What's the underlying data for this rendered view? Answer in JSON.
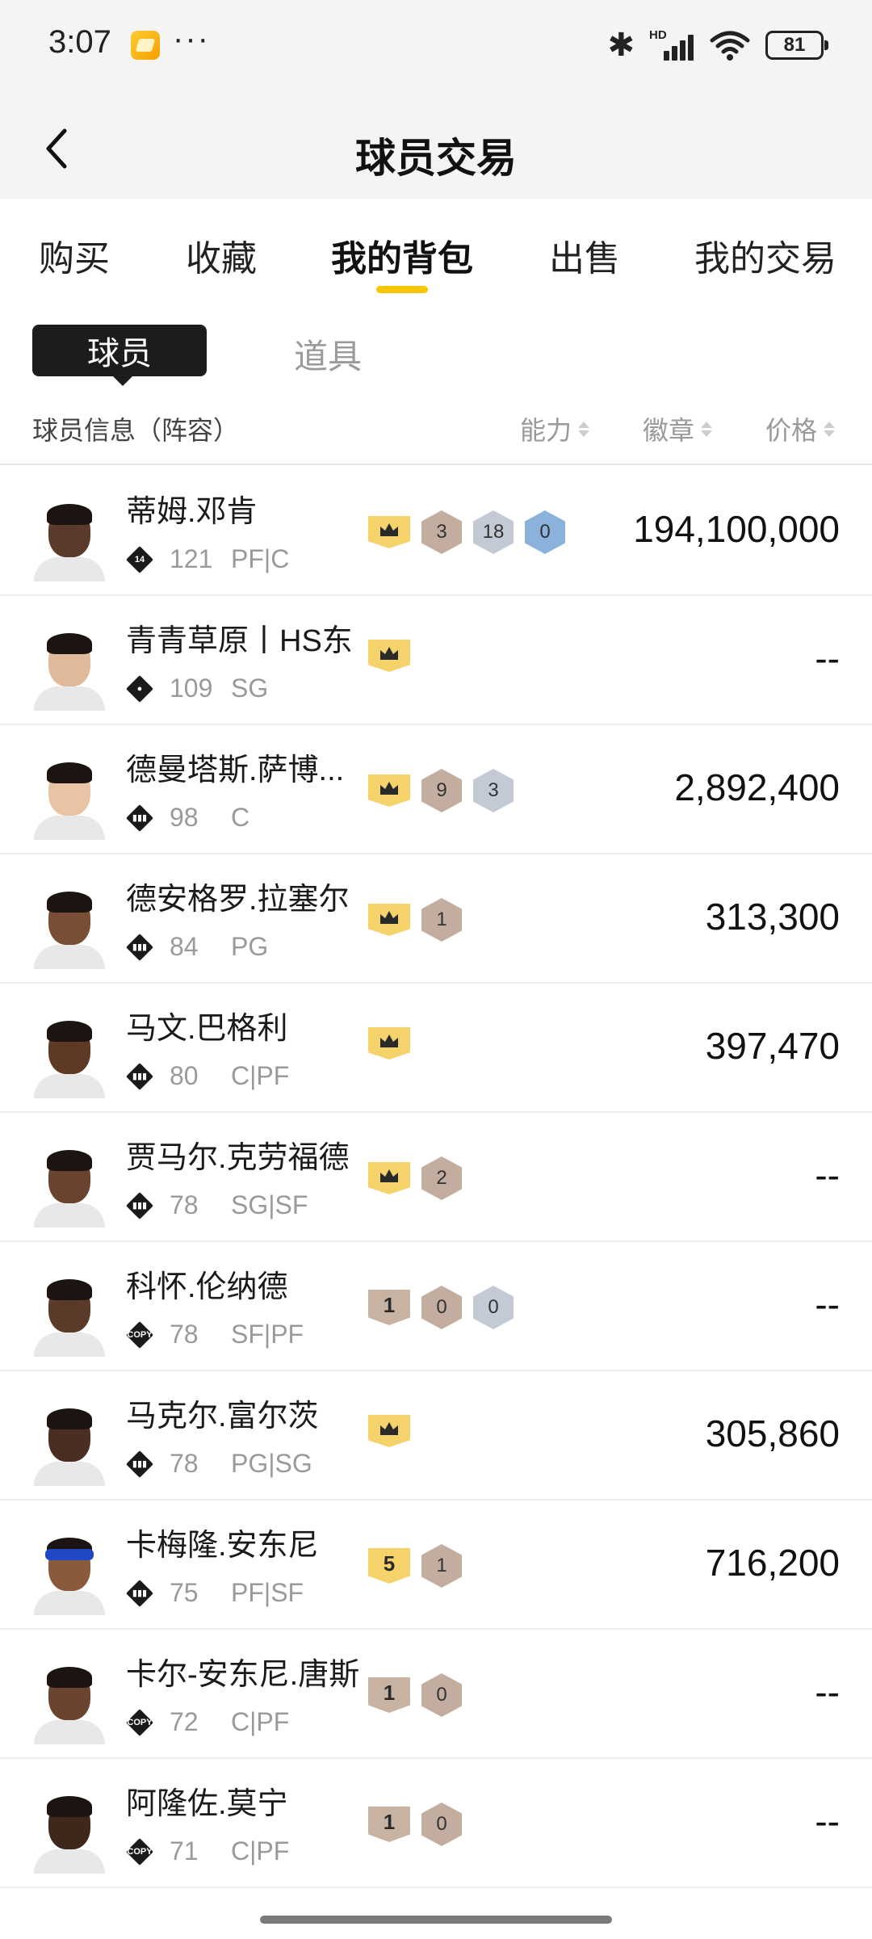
{
  "status_bar": {
    "time": "3:07",
    "dots": "···",
    "battery": "81",
    "network_label": "HD",
    "icons": [
      "app-icon",
      "bluetooth-icon",
      "signal-icon",
      "wifi-icon",
      "battery-icon"
    ]
  },
  "header": {
    "title": "球员交易",
    "back_icon": "chevron-left-icon"
  },
  "main_tabs": [
    {
      "label": "购买",
      "active": false
    },
    {
      "label": "收藏",
      "active": false
    },
    {
      "label": "我的背包",
      "active": true
    },
    {
      "label": "出售",
      "active": false
    },
    {
      "label": "我的交易",
      "active": false
    }
  ],
  "sub_tabs": [
    {
      "label": "球员",
      "active": true
    },
    {
      "label": "道具",
      "active": false
    }
  ],
  "columns": {
    "info": "球员信息（阵容）",
    "ability": "能力",
    "badges": "徽章",
    "price": "价格"
  },
  "colors": {
    "accent": "#f7c600",
    "crown_badge": "#f5d36a",
    "bronze": "#c3ada0",
    "silver": "#c3cad6",
    "blue": "#8ab2db"
  },
  "players": [
    {
      "name": "蒂姆.邓肯",
      "level_icon": "14",
      "ovr": "121",
      "pos": "PF|C",
      "badges": [
        {
          "type": "crown"
        },
        {
          "type": "hex",
          "color": "bronze",
          "value": "3"
        },
        {
          "type": "hex",
          "color": "silver",
          "value": "18"
        },
        {
          "type": "hex",
          "color": "blue",
          "value": "0"
        }
      ],
      "price": "194,100,000"
    },
    {
      "name": "青青草原丨HS东",
      "level_icon": "user",
      "ovr": "109",
      "pos": "SG",
      "badges": [
        {
          "type": "crown"
        }
      ],
      "price": "--"
    },
    {
      "name": "德曼塔斯.萨博...",
      "level_icon": "bars",
      "ovr": "98",
      "pos": "C",
      "badges": [
        {
          "type": "crown"
        },
        {
          "type": "hex",
          "color": "bronze",
          "value": "9"
        },
        {
          "type": "hex",
          "color": "silver",
          "value": "3"
        }
      ],
      "price": "2,892,400"
    },
    {
      "name": "德安格罗.拉塞尔",
      "level_icon": "bars",
      "ovr": "84",
      "pos": "PG",
      "badges": [
        {
          "type": "crown"
        },
        {
          "type": "hex",
          "color": "bronze",
          "value": "1"
        }
      ],
      "price": "313,300"
    },
    {
      "name": "马文.巴格利",
      "level_icon": "bars",
      "ovr": "80",
      "pos": "C|PF",
      "badges": [
        {
          "type": "crown"
        }
      ],
      "price": "397,470"
    },
    {
      "name": "贾马尔.克劳福德",
      "level_icon": "bars",
      "ovr": "78",
      "pos": "SG|SF",
      "badges": [
        {
          "type": "crown"
        },
        {
          "type": "hex",
          "color": "bronze",
          "value": "2"
        }
      ],
      "price": "--"
    },
    {
      "name": "科怀.伦纳德",
      "level_icon": "COPY",
      "ovr": "78",
      "pos": "SF|PF",
      "badges": [
        {
          "type": "num",
          "color": "bronze",
          "value": "1"
        },
        {
          "type": "hex",
          "color": "bronze",
          "value": "0"
        },
        {
          "type": "hex",
          "color": "silver",
          "value": "0"
        }
      ],
      "price": "--"
    },
    {
      "name": "马克尔.富尔茨",
      "level_icon": "bars",
      "ovr": "78",
      "pos": "PG|SG",
      "badges": [
        {
          "type": "crown"
        }
      ],
      "price": "305,860"
    },
    {
      "name": "卡梅隆.安东尼",
      "level_icon": "bars",
      "ovr": "75",
      "pos": "PF|SF",
      "badges": [
        {
          "type": "num",
          "color": "gold",
          "value": "5"
        },
        {
          "type": "hex",
          "color": "bronze",
          "value": "1"
        }
      ],
      "price": "716,200"
    },
    {
      "name": "卡尔-安东尼.唐斯",
      "level_icon": "COPY",
      "ovr": "72",
      "pos": "C|PF",
      "badges": [
        {
          "type": "num",
          "color": "bronze",
          "value": "1"
        },
        {
          "type": "hex",
          "color": "bronze",
          "value": "0"
        }
      ],
      "price": "--"
    },
    {
      "name": "阿隆佐.莫宁",
      "level_icon": "COPY",
      "ovr": "71",
      "pos": "C|PF",
      "badges": [
        {
          "type": "num",
          "color": "bronze",
          "value": "1"
        },
        {
          "type": "hex",
          "color": "bronze",
          "value": "0"
        }
      ],
      "price": "--"
    }
  ]
}
